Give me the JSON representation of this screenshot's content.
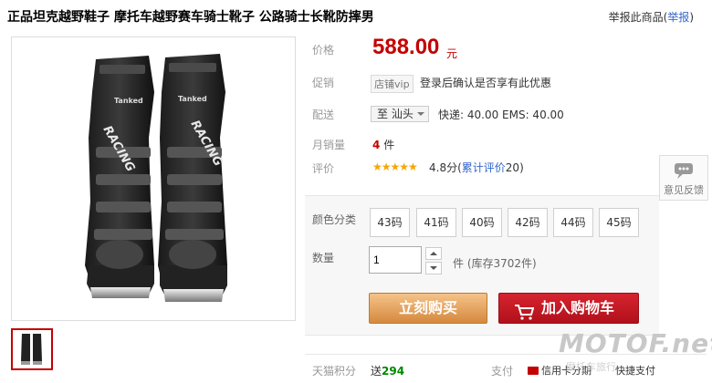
{
  "header": {
    "title": "正品坦克越野鞋子  摩托车越野赛车骑士靴子  公路骑士长靴防摔男",
    "report_prefix": "举报此商品(",
    "report_link": "举报",
    "report_suffix": ")"
  },
  "product_images": {
    "brand_text": "Tanked",
    "left_boot_text": "RACING",
    "right_boot_text": "RACING"
  },
  "price": {
    "label": "价格",
    "value": "588.00",
    "unit": "元"
  },
  "promotion": {
    "label": "促销",
    "badge": "店铺vip",
    "text": "登录后确认是否享有此优惠"
  },
  "shipping": {
    "label": "配送",
    "destination": "至 汕头",
    "text": "快递: 40.00 EMS: 40.00"
  },
  "sales": {
    "label": "月销量",
    "count": "4",
    "unit": "件"
  },
  "rating": {
    "label": "评价",
    "stars": "★★★★★",
    "score": "4.8分",
    "reviews_prefix": "(",
    "reviews_link": "累计评价",
    "reviews_count": "20",
    "reviews_suffix": ")"
  },
  "options": {
    "color_label": "颜色分类",
    "sizes": [
      "43码",
      "41码",
      "40码",
      "42码",
      "44码",
      "45码"
    ]
  },
  "quantity": {
    "label": "数量",
    "value": "1",
    "stock_text": "件  (库存3702件)"
  },
  "actions": {
    "buy_now": "立刻购买",
    "add_to_cart": "加入购物车"
  },
  "points": {
    "label": "天猫积分",
    "prefix": "送",
    "value": "294"
  },
  "payment": {
    "label": "支付",
    "items": [
      "信用卡分期",
      "快捷支付"
    ]
  },
  "feedback": {
    "label": "意见反馈"
  },
  "watermark": {
    "text": "MOTOF.net",
    "sub": "摩托车旅行"
  },
  "colors": {
    "price_red": "#c40000",
    "buy_orange": "#d5893e",
    "cart_red": "#c01822",
    "link_blue": "#3366cc",
    "star_gold": "#f7a600"
  }
}
